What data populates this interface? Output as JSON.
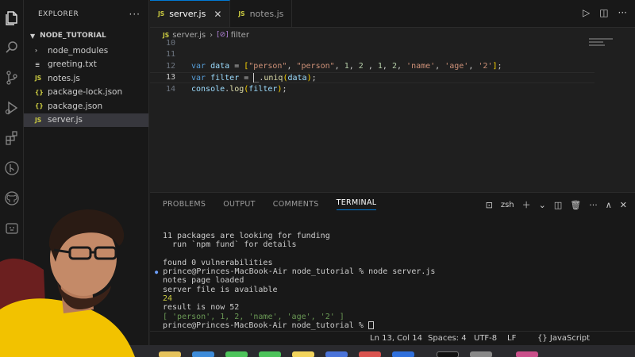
{
  "sidebar": {
    "title": "EXPLORER",
    "project": "NODE_TUTORIAL",
    "items": [
      {
        "label": "node_modules",
        "type": "folder"
      },
      {
        "label": "greeting.txt",
        "type": "txt"
      },
      {
        "label": "notes.js",
        "type": "js"
      },
      {
        "label": "package-lock.json",
        "type": "json"
      },
      {
        "label": "package.json",
        "type": "json"
      },
      {
        "label": "server.js",
        "type": "js",
        "active": true
      }
    ]
  },
  "tabs": [
    {
      "label": "server.js",
      "badge": "JS",
      "active": true
    },
    {
      "label": "notes.js",
      "badge": "JS",
      "active": false
    }
  ],
  "breadcrumb": {
    "file": "server.js",
    "symbol": "filter",
    "badge": "JS"
  },
  "code": {
    "line_numbers": [
      "10",
      "11",
      "12",
      "13",
      "14"
    ],
    "current_line": "13"
  },
  "panel": {
    "tabs": [
      "PROBLEMS",
      "OUTPUT",
      "COMMENTS",
      "TERMINAL"
    ],
    "active_tab": "TERMINAL",
    "shell": "zsh",
    "terminal_lines": [
      "11 packages are looking for funding",
      "  run `npm fund` for details",
      "",
      "found 0 vulnerabilities",
      "prince@Princes-MacBook-Air node_tutorial % node server.js",
      "notes page loaded",
      "server file is available",
      "24",
      "result is now 52",
      "[ 'person', 1, 2, 'name', 'age', '2' ]",
      "prince@Princes-MacBook-Air node_tutorial % "
    ]
  },
  "status": {
    "position": "Ln 13, Col 14",
    "spaces": "Spaces: 4",
    "encoding": "UTF-8",
    "eol": "LF",
    "language": "JavaScript"
  },
  "colors": {
    "accent": "#0078d4",
    "js_icon": "#cbcb41",
    "keyword": "#569cd6",
    "string": "#ce9178",
    "number": "#b5cea8"
  }
}
